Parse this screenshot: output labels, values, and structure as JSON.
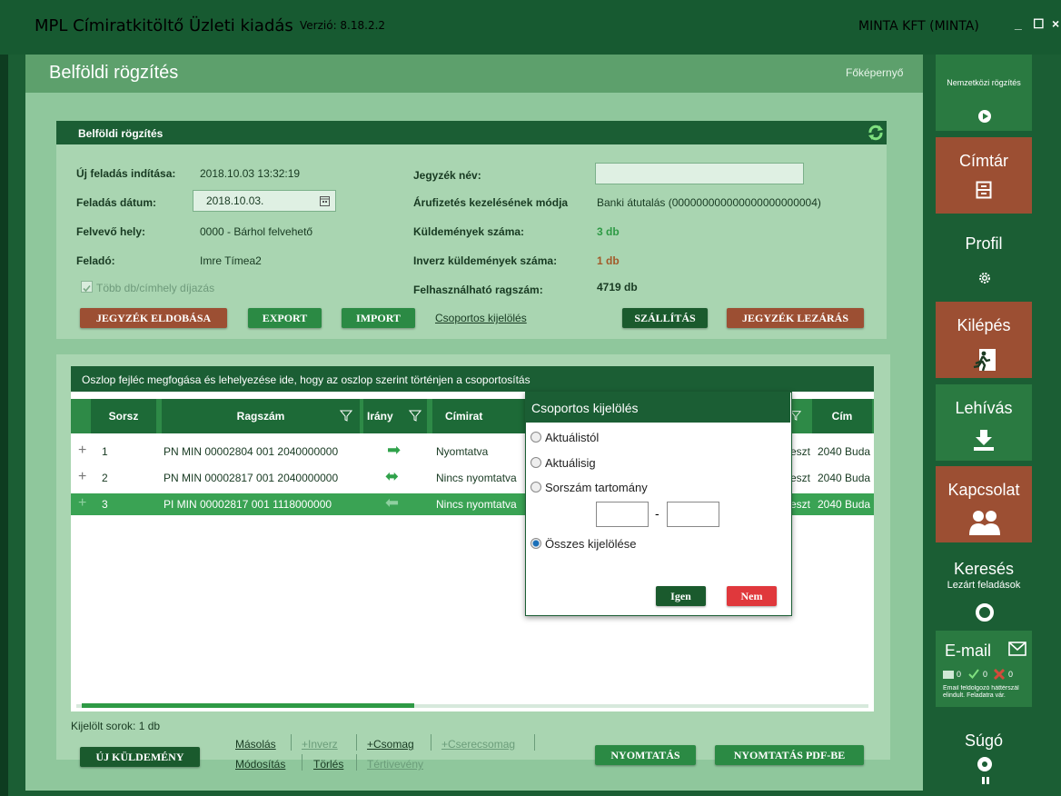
{
  "window": {
    "title": "MPL Címiratkitöltő Üzleti kiadás",
    "version": "Verzió: 8.18.2.2",
    "company": "MINTA KFT (MINTA)",
    "controls": [
      "_",
      "☐",
      "×"
    ]
  },
  "header": {
    "title": "Belföldi rögzítés",
    "home_link": "Főképernyő"
  },
  "panel1": {
    "title": "Belföldi rögzítés",
    "fields": {
      "uj_feladas_label": "Új feladás indítása:",
      "uj_feladas_value": "2018.10.03 13:32:19",
      "feladas_datum_label": "Feladás dátum:",
      "feladas_datum_value": "2018.10.03.",
      "felvevo_hely_label": "Felvevő hely:",
      "felvevo_hely_value": "0000 - Bárhol felvehető",
      "felado_label": "Feladó:",
      "felado_value": "Imre Tímea2",
      "tobb_db_label": "Több db/címhely díjazás",
      "jegyzek_nev_label": "Jegyzék név:",
      "jegyzek_nev_value": "",
      "arufizetes_label": "Árufizetés kezelésének módja",
      "arufizetes_value": "Banki átutalás (000000000000000000000004)",
      "kuldemenyek_label": "Küldemények száma:",
      "kuldemenyek_value": "3 db",
      "inverz_label": "Inverz küldemények száma:",
      "inverz_value": "1 db",
      "ragszam_label": "Felhasználható ragszám:",
      "ragszam_value": "4719 db"
    },
    "buttons": {
      "eldobas": "JEGYZÉK ELDOBÁSA",
      "export": "EXPORT",
      "import": "IMPORT",
      "csoportos": "Csoportos kijelölés",
      "szallitas": "SZÁLLÍTÁS",
      "lezaras": "JEGYZÉK LEZÁRÁS"
    }
  },
  "grid": {
    "group_hint": "Oszlop fejléc megfogása és lehelyezése ide, hogy az oszlop szerint történjen a csoportosítás",
    "columns": [
      "Sorsz",
      "Ragszám",
      "Irány",
      "Címirat",
      "Cím"
    ],
    "rows": [
      {
        "expand": "+",
        "sorsz": "1",
        "ragszam": "PN MIN 00002804 001 2040000000",
        "irany": "➡",
        "cimirat": "Nyomtatva",
        "cim_prefix": "eszt",
        "cim": "2040 Buda"
      },
      {
        "expand": "+",
        "sorsz": "2",
        "ragszam": "PN MIN 00002817 001 2040000000",
        "irany": "⬌",
        "cimirat": "Nincs nyomtatva",
        "cim_prefix": "eszt",
        "cim": "2040 Buda"
      },
      {
        "expand": "+",
        "sorsz": "3",
        "ragszam": "PI MIN 00002817 001 1118000000",
        "irany": "⬅",
        "cimirat": "Nincs nyomtatva",
        "cim_prefix": "eszt",
        "cim": "2040 Buda"
      }
    ],
    "selected_count": "Kijelölt sorok: 1 db"
  },
  "bottom": {
    "uj_kuldemeny": "ÚJ KÜLDEMÉNY",
    "masolas": "Másolás",
    "inverz": "+Inverz",
    "csomag": "+Csomag",
    "cserecsomag": "+Cserecsomag",
    "modositas": "Módosítás",
    "torles": "Törlés",
    "tertiveveny": "Tértivevény",
    "nyomtatas": "NYOMTATÁS",
    "nyomtatas_pdf": "NYOMTATÁS PDF-BE"
  },
  "dialog": {
    "title": "Csoportos kijelölés",
    "options": [
      "Aktuálistól",
      "Aktuálisig",
      "Sorszám tartomány",
      "Összes kijelölése"
    ],
    "selected_option": "Összes kijelölése",
    "range_separator": "-",
    "yes": "Igen",
    "no": "Nem"
  },
  "sidebar": {
    "nemzetkozi": "Nemzetközi rögzítés",
    "cimtar": "Címtár",
    "profil": "Profil",
    "kilepes": "Kilépés",
    "lehivas": "Lehívás",
    "kapcsolat": "Kapcsolat",
    "kereses": "Keresés",
    "kereses_sub": "Lezárt feladások",
    "email": "E-mail",
    "email_counts": [
      "0",
      "0",
      "0"
    ],
    "email_note": "Email feldolgozó háttérszál elindult. Feladatra vár.",
    "sugo": "Súgó"
  },
  "colors": {
    "dark_green": "#1b5e34",
    "panel_green": "#8fc79c",
    "brown": "#9c4f33",
    "red": "#e0383c"
  }
}
